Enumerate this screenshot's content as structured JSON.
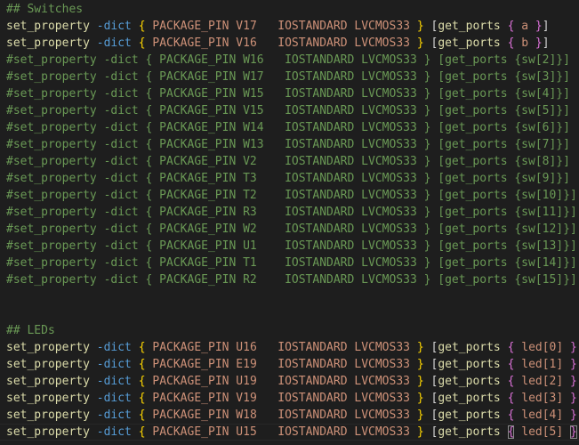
{
  "editor": {
    "theme": {
      "background": "#1e1e1e",
      "comment": "#6a9955",
      "function": "#dcdcaa",
      "keyword": "#569cd6",
      "bracket_level1": "#ffd700",
      "bracket_level2": "#da70d6",
      "string": "#ce9178",
      "text": "#d4d4d4"
    },
    "lines": [
      {
        "type": "comment",
        "text": "## Switches"
      },
      {
        "type": "code",
        "pin": "V17",
        "port": "a"
      },
      {
        "type": "code",
        "pin": "V16",
        "port": "b"
      },
      {
        "type": "comment",
        "text": "#set_property -dict { PACKAGE_PIN W16   IOSTANDARD LVCMOS33 } [get_ports {sw[2]}]"
      },
      {
        "type": "comment",
        "text": "#set_property -dict { PACKAGE_PIN W17   IOSTANDARD LVCMOS33 } [get_ports {sw[3]}]"
      },
      {
        "type": "comment",
        "text": "#set_property -dict { PACKAGE_PIN W15   IOSTANDARD LVCMOS33 } [get_ports {sw[4]}]"
      },
      {
        "type": "comment",
        "text": "#set_property -dict { PACKAGE_PIN V15   IOSTANDARD LVCMOS33 } [get_ports {sw[5]}]"
      },
      {
        "type": "comment",
        "text": "#set_property -dict { PACKAGE_PIN W14   IOSTANDARD LVCMOS33 } [get_ports {sw[6]}]"
      },
      {
        "type": "comment",
        "text": "#set_property -dict { PACKAGE_PIN W13   IOSTANDARD LVCMOS33 } [get_ports {sw[7]}]"
      },
      {
        "type": "comment",
        "text": "#set_property -dict { PACKAGE_PIN V2    IOSTANDARD LVCMOS33 } [get_ports {sw[8]}]"
      },
      {
        "type": "comment",
        "text": "#set_property -dict { PACKAGE_PIN T3    IOSTANDARD LVCMOS33 } [get_ports {sw[9]}]"
      },
      {
        "type": "comment",
        "text": "#set_property -dict { PACKAGE_PIN T2    IOSTANDARD LVCMOS33 } [get_ports {sw[10]}]"
      },
      {
        "type": "comment",
        "text": "#set_property -dict { PACKAGE_PIN R3    IOSTANDARD LVCMOS33 } [get_ports {sw[11]}]"
      },
      {
        "type": "comment",
        "text": "#set_property -dict { PACKAGE_PIN W2    IOSTANDARD LVCMOS33 } [get_ports {sw[12]}]"
      },
      {
        "type": "comment",
        "text": "#set_property -dict { PACKAGE_PIN U1    IOSTANDARD LVCMOS33 } [get_ports {sw[13]}]"
      },
      {
        "type": "comment",
        "text": "#set_property -dict { PACKAGE_PIN T1    IOSTANDARD LVCMOS33 } [get_ports {sw[14]}]"
      },
      {
        "type": "comment",
        "text": "#set_property -dict { PACKAGE_PIN R2    IOSTANDARD LVCMOS33 } [get_ports {sw[15]}]"
      },
      {
        "type": "blank"
      },
      {
        "type": "blank"
      },
      {
        "type": "comment",
        "text": "## LEDs"
      },
      {
        "type": "code",
        "pin": "U16",
        "port": "led[0]"
      },
      {
        "type": "code",
        "pin": "E19",
        "port": "led[1]"
      },
      {
        "type": "code",
        "pin": "U19",
        "port": "led[2]"
      },
      {
        "type": "code",
        "pin": "V19",
        "port": "led[3]"
      },
      {
        "type": "code",
        "pin": "W18",
        "port": "led[4]"
      },
      {
        "type": "code",
        "pin": "U15",
        "port": "led[5]",
        "current": true
      }
    ],
    "tokens": {
      "cmd": "set_property",
      "flag": "-dict",
      "pin_key": "PACKAGE_PIN",
      "io_key": "IOSTANDARD",
      "io_val": "LVCMOS33",
      "ports_fn": "get_ports"
    }
  }
}
